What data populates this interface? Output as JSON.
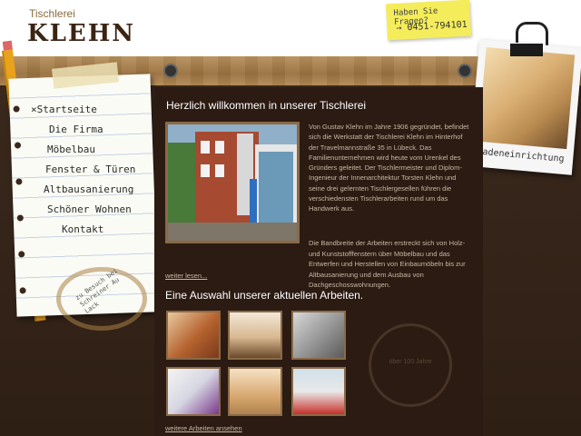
{
  "header": {
    "logo_small": "Tischlerei",
    "logo_big": "KLEHN",
    "sticky_line1": "Haben Sie Fragen?",
    "sticky_line2": "→ 0451-794101"
  },
  "nav": {
    "items": [
      "×Startseite",
      "Die Firma",
      "Möbelbau",
      "Fenster & Türen",
      "Altbausanierung",
      "Schöner Wohnen",
      "Kontakt"
    ]
  },
  "notepad": {
    "stain_text": "zu Besuch bei Schreiner Au Lack"
  },
  "polaroid": {
    "caption": "Ladeneinrichtung"
  },
  "content": {
    "title": "Herzlich willkommen in unserer Tischlerei",
    "intro": "Von Gustav Klehn im Jahre 1906 gegründet, befindet sich die Werkstatt der Tischlerei Klehn im Hinterhof der Travelmannstraße 35 in Lübeck. Das Familienunternehmen wird heute vom Urenkel des Gründers geleitet. Der Tischlermeister und Diplom- Ingenieur der Innenarchitektur Torsten Klehn und seine drei gelernten Tischlergesellen führen die verschiedensten Tischlerarbeiten rund um das Handwerk aus.",
    "para2": "Die Bandbreite der Arbeiten erstreckt sich von Holz- und Kunststofffenstern über Möbelbau und das Entwerfen und Herstellen von Einbaumöbeln bis zur Altbausanierung und dem Ausbau von Dachgeschosswohnungen.",
    "more_link": "weiter lesen...",
    "works_title": "Eine Auswahl unserer aktuellen Arbeiten.",
    "works_link": "weitere Arbeiten ansehen"
  },
  "stamp_text": "über 100 Jahre"
}
